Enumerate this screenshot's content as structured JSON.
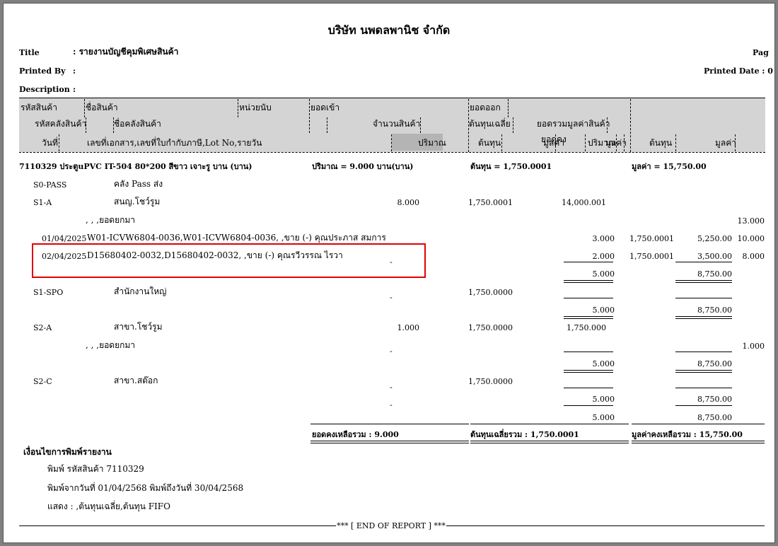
{
  "report": {
    "company": "บริษัท นพดลพานิช จำกัด",
    "title_label": "Title",
    "title_value": ": รายงานบัญชีคุมพิเศษสินค้า",
    "printed_by_label": "Printed By",
    "printed_by_value": ":",
    "description_label": "Description",
    "description_value": ":",
    "page_label": "Pag",
    "printed_date": "Printed Date : 0"
  },
  "columns": {
    "row1": {
      "code": "รหัสสินค้า",
      "name": "ชื่อสินค้า",
      "unit": "หน่วยนับ",
      "in_total": "ยอดเข้า",
      "out_total": "ยอดออก"
    },
    "row2": {
      "wh_code": "รหัสคลังสินค้า",
      "wh_name": "ชื่อคลังสินค้า",
      "qty": "จำนวนสินค้า",
      "avg_cost": "ต้นทุนเฉลี่ย",
      "total_value": "ยอดรวมมูลค่าสินค้า"
    },
    "row3": {
      "date": "วันที่",
      "doc": "เลขที่เอกสาร,เลขที่ใบกำกับภาษี,Lot No,รายวัน",
      "qty_in": "ปริมาณ",
      "cost_in": "ต้นทุน",
      "value_in": "มูลค่า",
      "qty_out": "ปริมาณ",
      "value_out": "มูลค่า",
      "cost_bal": "ต้นทุน",
      "value_bal": "มูลค่า",
      "value_in_b": "ยอดคง"
    }
  },
  "product": {
    "line": "7110329      ประตูuPVC  IT-504  80*200 สีขาว เจาะรู บาน (บาน)",
    "qty": "ปริมาณ = 9.000 บาน(บาน)",
    "cost": "ต้นทุน = 1,750.0001",
    "value": "มูลค่า = 15,750.00"
  },
  "rows": {
    "s0_code": "S0-PASS",
    "s0_name": "คลัง Pass ส่ง",
    "s1a_code": "S1-A",
    "s1a_name": "สนญ.โชว์รูม",
    "s1a_qty": "8.000",
    "s1a_cost": "1,750.0001",
    "s1a_value": "14,000.001",
    "carry": ", , ,ยอดยกมา",
    "carry_val1": "13.000",
    "t1_date": "01/04/2025",
    "t1_doc": "W01-ICVW6804-0036,W01-ICVW6804-0036,  ,ขาย (-) คุณประภาส สมการ",
    "t1_qty": "3.000",
    "t1_cost": "1,750.0001",
    "t1_value": "5,250.00",
    "t1_bal": "10.000",
    "t2_date": "02/04/2025",
    "t2_doc": "D15680402-0032,D15680402-0032,  ,ขาย (-) คุณรวีวรรณ ไรวา",
    "t2_qty": "2.000",
    "t2_cost": "1,750.0001",
    "t2_value": "3,500.00",
    "t2_bal": "8.000",
    "dash": "-",
    "sub1_qty": "5.000",
    "sub1_value": "8,750.00",
    "s1spo_code": "S1-SPO",
    "s1spo_name": "สำนักงานใหญ่",
    "s1spo_cost": "1,750.0000",
    "sub2_qty": "5.000",
    "sub2_value": "8,750.00",
    "s2a_code": "S2-A",
    "s2a_name": "สาขา.โชว์รูม",
    "s2a_qty": "1.000",
    "s2a_cost": "1,750.0000",
    "s2a_value": "1,750.000",
    "carry2": ", , ,ยอดยกมา",
    "carry2_val": "1.000",
    "sub3_qty": "5.000",
    "sub3_value": "8,750.00",
    "s2c_code": "S2-C",
    "s2c_name": "สาขา.สต๊อก",
    "s2c_cost": "1,750.0000",
    "sub4_qty": "5.000",
    "sub4_value": "8,750.00",
    "sub5_qty": "5.000",
    "sub5_value": "8,750.00"
  },
  "totals": {
    "qty": "ยอดคงเหลือรวม : 9.000",
    "cost": "ต้นทุนเฉลี่ยรวม : 1,750.0001",
    "value": "มูลค่าคงเหลือรวม : 15,750.00"
  },
  "conditions": {
    "heading": "เงื่อนไขการพิมพ์รายงาน",
    "line1": "พิมพ์ รหัสสินค้า  7110329",
    "line2": "พิมพ์จากวันที่  01/04/2568  พิมพ์ถึงวันที่  30/04/2568",
    "line3": "แสดง : ,ต้นทุนเฉลี่ย,ต้นทุน FIFO"
  },
  "footer": "*** [ END OF REPORT ] ***"
}
